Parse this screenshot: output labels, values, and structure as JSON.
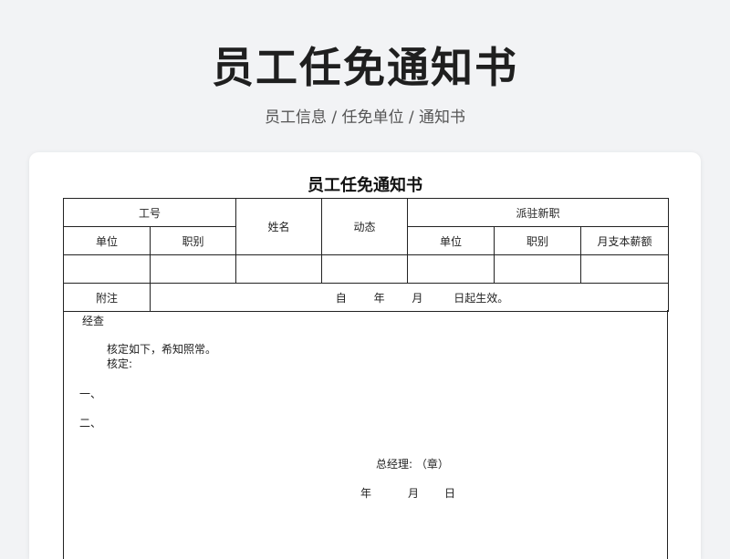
{
  "header": {
    "title": "员工任免通知书",
    "breadcrumb": "员工信息 / 任免单位 / 通知书"
  },
  "document": {
    "title": "员工任免通知书",
    "table": {
      "col_gonghao": "工号",
      "col_name": "姓名",
      "col_dongtai": "动态",
      "col_paizhu": "派驻新职",
      "sub_danwei": "单位",
      "sub_zhibie": "职别",
      "sub_danwei2": "单位",
      "sub_zhibie2": "职别",
      "sub_salary": "月支本薪额",
      "remark_label": "附注",
      "remark_zi": "自",
      "remark_nian": "年",
      "remark_yue": "月",
      "remark_ri": "日起生效。"
    },
    "body": {
      "jingcha": "经查",
      "line1": "核定如下，希知照常。",
      "line2": "核定:",
      "item1": "一、",
      "item2": "二、",
      "manager": "总经理:  （章）",
      "date_nian": "年",
      "date_yue": "月",
      "date_ri": "日"
    }
  }
}
